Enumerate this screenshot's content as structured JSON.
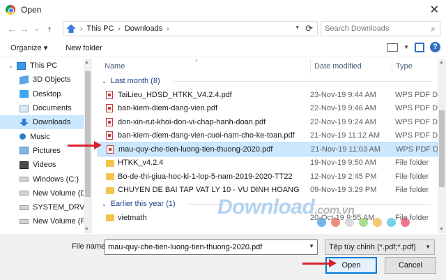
{
  "window": {
    "title": "Open",
    "close_glyph": "✕"
  },
  "nav": {
    "back": "←",
    "forward": "→",
    "dropdown": "⌄",
    "up": "↑",
    "crumbs": [
      "This PC",
      "Downloads"
    ],
    "refresh": "⟳",
    "search_placeholder": "Search Downloads"
  },
  "toolbar": {
    "organize": "Organize ▾",
    "new_folder": "New folder",
    "help": "?"
  },
  "sidebar": {
    "items": [
      {
        "label": "This PC",
        "icon": "pc-icon",
        "arrow": "⌄"
      },
      {
        "label": "3D Objects",
        "icon": "cube-icon"
      },
      {
        "label": "Desktop",
        "icon": "desktop-icon"
      },
      {
        "label": "Documents",
        "icon": "documents-icon"
      },
      {
        "label": "Downloads",
        "icon": "download-icon",
        "selected": true
      },
      {
        "label": "Music",
        "icon": "music-icon"
      },
      {
        "label": "Pictures",
        "icon": "pictures-icon"
      },
      {
        "label": "Videos",
        "icon": "videos-icon"
      },
      {
        "label": "Windows (C:)",
        "icon": "drive-icon"
      },
      {
        "label": "New Volume (D:)",
        "icon": "drive-icon"
      },
      {
        "label": "SYSTEM_DRV (E:)",
        "icon": "drive-icon"
      },
      {
        "label": "New Volume (F:)",
        "icon": "drive-icon"
      }
    ]
  },
  "columns": {
    "name": "Name",
    "date": "Date modified",
    "type": "Type"
  },
  "groups": [
    {
      "label": "Last month (8)",
      "files": [
        {
          "name": "TaiLieu_HDSD_HTKK_V4.2.4.pdf",
          "date": "23-Nov-19 9:44 AM",
          "type": "WPS PDF Do",
          "kind": "pdf"
        },
        {
          "name": "ban-kiem-diem-dang-vien.pdf",
          "date": "22-Nov-19 9:46 AM",
          "type": "WPS PDF Do",
          "kind": "pdf"
        },
        {
          "name": "don-xin-rut-khoi-don-vi-chap-hanh-doan.pdf",
          "date": "22-Nov-19 9:24 AM",
          "type": "WPS PDF Do",
          "kind": "pdf"
        },
        {
          "name": "ban-kiem-diem-dang-vien-cuoi-nam-cho-ke-toan.pdf",
          "date": "21-Nov-19 11:12 AM",
          "type": "WPS PDF Do",
          "kind": "pdf"
        },
        {
          "name": "mau-quy-che-tien-luong-tien-thuong-2020.pdf",
          "date": "21-Nov-19 11:03 AM",
          "type": "WPS PDF Do",
          "kind": "pdf",
          "selected": true
        },
        {
          "name": "HTKK_v4.2.4",
          "date": "19-Nov-19 9:50 AM",
          "type": "File folder",
          "kind": "folder"
        },
        {
          "name": "Bo-de-thi-giua-hoc-ki-1-lop-5-nam-2019-2020-TT22",
          "date": "12-Nov-19 2:45 PM",
          "type": "File folder",
          "kind": "folder"
        },
        {
          "name": "CHUYEN DE BAI TAP VAT LY 10 - VU DINH HOANG",
          "date": "09-Nov-19 3:29 PM",
          "type": "File folder",
          "kind": "folder"
        }
      ]
    },
    {
      "label": "Earlier this year (1)",
      "files": [
        {
          "name": "vietmath",
          "date": "20-Oct-19 9:55 AM",
          "type": "File folder",
          "kind": "folder"
        }
      ]
    }
  ],
  "bottom": {
    "file_name_label": "File name:",
    "file_name_value": "mau-quy-che-tien-luong-tien-thuong-2020.pdf",
    "filter": "Tệp tùy chỉnh (*.pdf;*.pdf)",
    "open_label": "Open",
    "cancel_label": "Cancel"
  },
  "watermark": {
    "text": "Download",
    "domain": ".com.vn",
    "dot_colors": [
      "#4a9be0",
      "#e86a5a",
      "#cfcfcf",
      "#8fd36a",
      "#f2b84a",
      "#4cc2e0",
      "#e84a6a"
    ]
  },
  "accent": {
    "selection": "#cce8ff",
    "arrow": "#d8232a",
    "button_focus": "#0078d7"
  }
}
